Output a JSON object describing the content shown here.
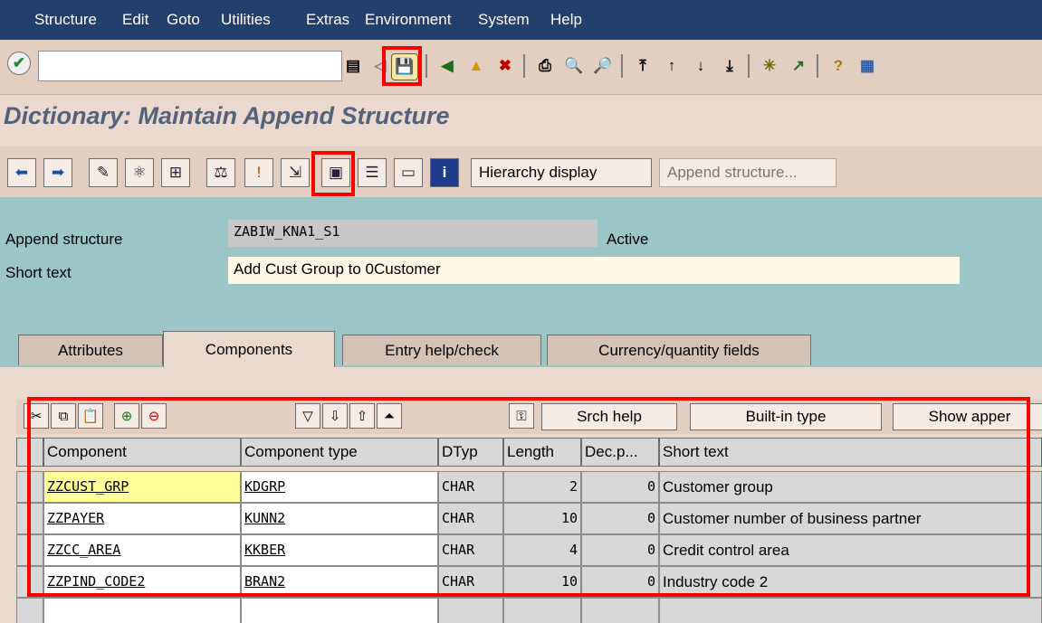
{
  "menu": {
    "items": [
      {
        "label": "Structure"
      },
      {
        "label": "Edit"
      },
      {
        "label": "Goto"
      },
      {
        "label": "Utilities"
      },
      {
        "label": "Extras"
      },
      {
        "label": "Environment"
      },
      {
        "label": "System"
      },
      {
        "label": "Help"
      }
    ]
  },
  "command_field": {
    "value": ""
  },
  "page": {
    "title": "Dictionary: Maintain Append Structure"
  },
  "toolbar2": {
    "hierarchy_display": "Hierarchy display",
    "append_structure": "Append structure..."
  },
  "header": {
    "append_structure_label": "Append structure",
    "append_structure_value": "ZABIW_KNA1_S1",
    "status": "Active",
    "short_text_label": "Short text",
    "short_text_value": "Add Cust Group to 0Customer"
  },
  "tabs": [
    {
      "label": "Attributes"
    },
    {
      "label": "Components"
    },
    {
      "label": "Entry help/check"
    },
    {
      "label": "Currency/quantity fields"
    }
  ],
  "table_toolbar": {
    "srch_help": "Srch help",
    "built_in_type": "Built-in type",
    "show_append": "Show apper"
  },
  "table": {
    "columns": [
      "Component",
      "Component type",
      "DTyp",
      "Length",
      "Dec.p...",
      "Short text"
    ],
    "rows": [
      {
        "component": "ZZCUST_GRP",
        "type": "KDGRP",
        "dtyp": "CHAR",
        "length": "2",
        "dec": "0",
        "short_text": "Customer group"
      },
      {
        "component": "ZZPAYER",
        "type": "KUNN2",
        "dtyp": "CHAR",
        "length": "10",
        "dec": "0",
        "short_text": "Customer number of business partner"
      },
      {
        "component": "ZZCC_AREA",
        "type": "KKBER",
        "dtyp": "CHAR",
        "length": "4",
        "dec": "0",
        "short_text": "Credit control area"
      },
      {
        "component": "ZZPIND_CODE2",
        "type": "BRAN2",
        "dtyp": "CHAR",
        "length": "10",
        "dec": "0",
        "short_text": "Industry code 2"
      }
    ]
  },
  "colors": {
    "menubar": "#233f6b",
    "body": "#ead9cf",
    "teal": "#9cc6c6",
    "highlight": "#ff0000"
  }
}
